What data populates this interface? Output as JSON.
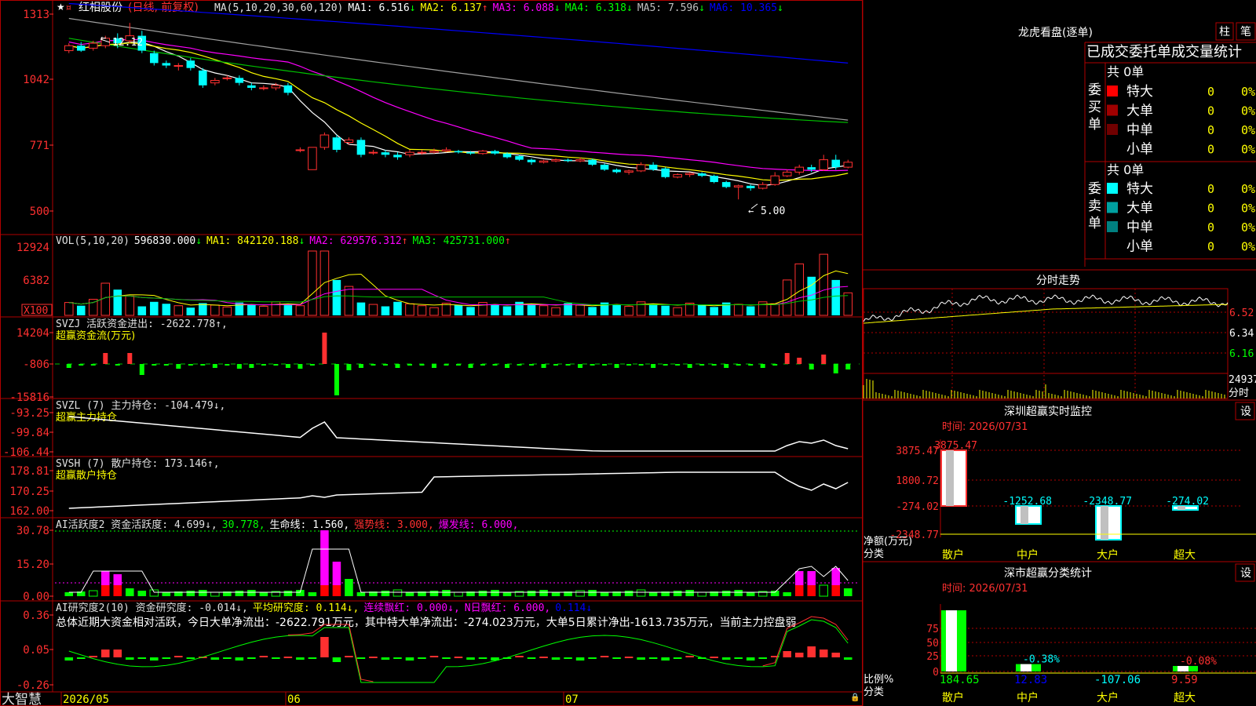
{
  "stock": {
    "name": "红相股份",
    "mode": "(日线, 前复权)"
  },
  "footer": {
    "logo": "大智慧",
    "dates": [
      "2026/05",
      "06",
      "07"
    ]
  },
  "price_panel": {
    "y_labels": [
      "1313",
      "1042",
      "771",
      "500"
    ],
    "ma_items": [
      {
        "label": "MA(5,10,20,30,60,120)",
        "color": "#e0e0e0",
        "arrow": ""
      },
      {
        "label": "MA1: 6.516",
        "color": "#ffffff",
        "arrow": "↓",
        "arrow_color": "#00ff00"
      },
      {
        "label": "MA2: 6.137",
        "color": "#ffff00",
        "arrow": "↑",
        "arrow_color": "#ff3030"
      },
      {
        "label": "MA3: 6.088",
        "color": "#ff00ff",
        "arrow": "↓",
        "arrow_color": "#00ff00"
      },
      {
        "label": "MA4: 6.318",
        "color": "#00ff00",
        "arrow": "↓",
        "arrow_color": "#00ff00"
      },
      {
        "label": "MA5: 7.596",
        "color": "#c0c0c0",
        "arrow": "↓",
        "arrow_color": "#00ff00"
      },
      {
        "label": "MA6: 10.365",
        "color": "#0000ff",
        "arrow": "↓",
        "arrow_color": "#00ff00"
      }
    ],
    "high_label": "12.12",
    "low_label": "5.00"
  },
  "vol_panel": {
    "y_labels": [
      "12924",
      "6382",
      "X100"
    ],
    "items": [
      {
        "label": "VOL(5,10,20)",
        "color": "#e0e0e0",
        "arrow": ""
      },
      {
        "label": "596830.000",
        "color": "#ffffff",
        "arrow": "↓",
        "arrow_color": "#00ff00"
      },
      {
        "label": "MA1: 842120.188",
        "color": "#ffff00",
        "arrow": "↓",
        "arrow_color": "#00ff00"
      },
      {
        "label": "MA2: 629576.312",
        "color": "#ff00ff",
        "arrow": "↑",
        "arrow_color": "#ff3030"
      },
      {
        "label": "MA3: 425731.000",
        "color": "#00ff00",
        "arrow": "↑",
        "arrow_color": "#ff3030"
      }
    ]
  },
  "svzj_panel": {
    "y_labels": [
      "14204",
      "-806",
      "-15816"
    ],
    "line1": "SVZJ  活跃资金进出: -2622.778↑,",
    "line2": "超赢资金流(万元)"
  },
  "svzl_panel": {
    "y_labels": [
      "-93.25",
      "-99.84",
      "-106.44"
    ],
    "line1": "SVZL (7) 主力持仓: -104.479↓,",
    "line2": "超赢主力持仓"
  },
  "svsh_panel": {
    "y_labels": [
      "178.81",
      "170.25",
      "162.00"
    ],
    "line1": "SVSH (7) 散户持仓: 173.146↑,",
    "line2": "超赢散户持仓"
  },
  "ai_active_panel": {
    "y_labels": [
      "30.78",
      "15.20",
      "0.00"
    ],
    "items": [
      {
        "label": "AI活跃度2 资金活跃度: 4.699↓,",
        "color": "#e0e0e0"
      },
      {
        "label": "30.778,",
        "color": "#00ff00"
      },
      {
        "label": "生命线: 1.560,",
        "color": "#ffffff"
      },
      {
        "label": "强势线: 3.000,",
        "color": "#ff3030"
      },
      {
        "label": "爆发线: 6.000,",
        "color": "#ff00ff"
      }
    ]
  },
  "ai_research_panel": {
    "y_labels": [
      "0.36",
      "0.05",
      "-0.26"
    ],
    "items": [
      {
        "label": "AI研究度2(10) 资金研究度: -0.014↓,",
        "color": "#e0e0e0"
      },
      {
        "label": "平均研究度: 0.114↓,",
        "color": "#ffff00"
      },
      {
        "label": "连续飘红: 0.000↓,",
        "color": "#ff00ff"
      },
      {
        "label": "N日飘红: 6.000,",
        "color": "#ff00ff"
      },
      {
        "label": "0.114↓",
        "color": "#0000ff"
      }
    ],
    "summary": "总体近期大资金相对活跃，今日大单净流出：-2622.791万元，其中特大单净流出：-274.023万元，大单5日累计净出-1613.735万元，当前主力控盘弱"
  },
  "dragon_tiger": {
    "title": "龙虎看盘(逐单)",
    "btn_bar": "柱",
    "btn_pen": "笔",
    "tab": "已成交委托单成交量统计",
    "buy_label": "委买单",
    "sell_label": "委卖单",
    "buy_total": "共 0单",
    "sell_total": "共 0单",
    "buy_rows": [
      {
        "name": "特大",
        "count": "0",
        "pct": "0%",
        "color": "#ff0000"
      },
      {
        "name": "大单",
        "count": "0",
        "pct": "0%",
        "color": "#a00000"
      },
      {
        "name": "中单",
        "count": "0",
        "pct": "0%",
        "color": "#700000"
      },
      {
        "name": "小单",
        "count": "0",
        "pct": "0%",
        "color": ""
      }
    ],
    "sell_rows": [
      {
        "name": "特大",
        "count": "0",
        "pct": "0%",
        "color": "#00ffff"
      },
      {
        "name": "大单",
        "count": "0",
        "pct": "0%",
        "color": "#00a0a0"
      },
      {
        "name": "中单",
        "count": "0",
        "pct": "0%",
        "color": "#008080"
      },
      {
        "name": "小单",
        "count": "0",
        "pct": "0%",
        "color": ""
      }
    ]
  },
  "intraday": {
    "title": "分时走势",
    "y_labels": [
      "6.52",
      "6.34",
      "6.16"
    ],
    "vol_label": "24937",
    "vol_unit": "分时"
  },
  "sz_monitor": {
    "title": "深圳超赢实时监控",
    "settings": "设",
    "time": "时间: 2026/07/31",
    "y_labels": [
      "3875.47",
      "1800.72",
      "-274.02",
      "-2348.77"
    ],
    "axis_label_1": "净额(万元)",
    "axis_label_2": "分类",
    "bars": [
      {
        "category": "散户",
        "value": 3875.47,
        "label": "3875.47"
      },
      {
        "category": "中户",
        "value": -1252.68,
        "label": "-1252.68"
      },
      {
        "category": "大户",
        "value": -2348.77,
        "label": "-2348.77"
      },
      {
        "category": "超大",
        "value": -274.02,
        "label": "-274.02"
      }
    ]
  },
  "sz_classify": {
    "title": "深市超赢分类统计",
    "settings": "设",
    "time": "时间: 2026/07/31",
    "y_labels": [
      "75",
      "50",
      "25",
      "0"
    ],
    "axis_label_1": "比例%",
    "axis_label_2": "分类",
    "bars": [
      {
        "category": "散户",
        "value": 184.65,
        "label": "184.65",
        "pct": ""
      },
      {
        "category": "中户",
        "value": 12.83,
        "label": "12.83",
        "pct": "-0.38%"
      },
      {
        "category": "大户",
        "value": -107.06,
        "label": "-107.06",
        "pct": ""
      },
      {
        "category": "超大",
        "value": 9.59,
        "label": "9.59",
        "pct": "-0.08%"
      }
    ]
  },
  "chart_data": {
    "type": "candlestick",
    "title": "红相股份 (日线, 前复权)",
    "x_axis_labels": [
      "2026/05",
      "06",
      "07"
    ],
    "price_axis_ticks": [
      "1313",
      "1042",
      "771",
      "500"
    ],
    "price_high": 12.12,
    "price_low": 5.0,
    "ma_values": {
      "MA1": 6.516,
      "MA2": 6.137,
      "MA3": 6.088,
      "MA4": 6.318,
      "MA5": 7.596,
      "MA6": 10.365
    },
    "candles": [
      [
        11.0,
        11.2,
        11.3,
        10.9
      ],
      [
        11.2,
        11.0,
        11.35,
        10.95
      ],
      [
        11.1,
        11.3,
        11.4,
        11.0
      ],
      [
        11.2,
        11.5,
        11.6,
        11.1
      ],
      [
        11.5,
        11.3,
        11.7,
        11.1
      ],
      [
        11.4,
        11.6,
        12.12,
        11.3
      ],
      [
        11.6,
        11.0,
        11.8,
        10.9
      ],
      [
        10.9,
        10.5,
        11.0,
        10.4
      ],
      [
        10.5,
        10.4,
        10.6,
        10.3
      ],
      [
        10.4,
        10.4,
        10.5,
        10.2
      ],
      [
        10.6,
        10.3,
        10.7,
        10.2
      ],
      [
        10.2,
        9.6,
        10.3,
        9.5
      ],
      [
        9.7,
        9.8,
        9.9,
        9.6
      ],
      [
        9.9,
        9.9,
        10.0,
        9.8
      ],
      [
        9.9,
        9.7,
        10.0,
        9.6
      ],
      [
        9.6,
        9.5,
        9.7,
        9.4
      ],
      [
        9.5,
        9.5,
        9.6,
        9.4
      ],
      [
        9.5,
        9.6,
        9.7,
        9.4
      ],
      [
        9.6,
        9.3,
        9.7,
        9.2
      ],
      [
        7.0,
        7.0,
        7.1,
        6.9
      ],
      [
        6.2,
        7.1,
        7.1,
        6.2
      ],
      [
        7.1,
        7.6,
        7.7,
        7.0
      ],
      [
        7.5,
        7.0,
        7.6,
        6.9
      ],
      [
        7.3,
        7.4,
        7.5,
        7.2
      ],
      [
        7.4,
        6.8,
        7.5,
        6.7
      ],
      [
        6.9,
        6.9,
        7.0,
        6.8
      ],
      [
        6.9,
        6.8,
        7.0,
        6.7
      ],
      [
        6.8,
        6.7,
        6.9,
        6.6
      ],
      [
        6.8,
        6.9,
        7.0,
        6.7
      ],
      [
        6.9,
        6.9,
        7.0,
        6.8
      ],
      [
        6.9,
        6.95,
        7.05,
        6.85
      ],
      [
        6.95,
        7.0,
        7.1,
        6.9
      ],
      [
        6.95,
        6.9,
        7.0,
        6.85
      ],
      [
        6.9,
        6.85,
        6.95,
        6.8
      ],
      [
        6.85,
        6.95,
        7.0,
        6.8
      ],
      [
        6.95,
        6.85,
        7.0,
        6.8
      ],
      [
        6.85,
        6.7,
        6.9,
        6.65
      ],
      [
        6.75,
        6.6,
        6.8,
        6.55
      ],
      [
        6.6,
        6.5,
        6.65,
        6.4
      ],
      [
        6.5,
        6.55,
        6.6,
        6.45
      ],
      [
        6.55,
        6.6,
        6.65,
        6.5
      ],
      [
        6.6,
        6.55,
        6.65,
        6.5
      ],
      [
        6.55,
        6.6,
        6.7,
        6.5
      ],
      [
        6.6,
        6.4,
        6.65,
        6.35
      ],
      [
        6.4,
        6.2,
        6.45,
        6.15
      ],
      [
        6.2,
        6.1,
        6.25,
        6.05
      ],
      [
        6.1,
        6.15,
        6.2,
        6.0
      ],
      [
        6.15,
        6.4,
        6.5,
        6.1
      ],
      [
        6.4,
        6.2,
        6.5,
        6.15
      ],
      [
        6.25,
        5.9,
        6.3,
        5.85
      ],
      [
        5.9,
        6.0,
        6.05,
        5.85
      ],
      [
        6.0,
        6.05,
        6.1,
        5.9
      ],
      [
        6.05,
        5.95,
        6.1,
        5.9
      ],
      [
        5.95,
        5.7,
        6.0,
        5.65
      ],
      [
        5.7,
        5.5,
        5.75,
        5.45
      ],
      [
        5.5,
        5.55,
        5.6,
        5.0
      ],
      [
        5.55,
        5.45,
        5.6,
        5.35
      ],
      [
        5.45,
        5.6,
        5.7,
        5.4
      ],
      [
        5.6,
        5.95,
        6.1,
        5.55
      ],
      [
        5.95,
        6.1,
        6.2,
        5.9
      ],
      [
        6.1,
        6.3,
        6.4,
        6.0
      ],
      [
        6.3,
        6.2,
        6.4,
        6.1
      ],
      [
        6.2,
        6.6,
        6.8,
        6.15
      ],
      [
        6.6,
        6.3,
        6.8,
        6.2
      ],
      [
        6.3,
        6.5,
        6.6,
        6.25
      ]
    ],
    "volume_axis_ticks": [
      "12924",
      "6382",
      "X100"
    ],
    "svzj": {
      "value": -2622.778,
      "axis_ticks": [
        "14204",
        "-806",
        "-15816"
      ]
    },
    "svzl": {
      "value": -104.479,
      "axis_ticks": [
        "-93.25",
        "-99.84",
        "-106.44"
      ]
    },
    "svsh": {
      "value": 173.146,
      "axis_ticks": [
        "178.81",
        "170.25",
        "162.00"
      ]
    },
    "ai_active": {
      "value": 4.699,
      "axis_ticks": [
        "30.78",
        "15.20",
        "0.00"
      ]
    },
    "ai_research": {
      "value": -0.014,
      "axis_ticks": [
        "0.36",
        "0.05",
        "-0.26"
      ]
    }
  }
}
